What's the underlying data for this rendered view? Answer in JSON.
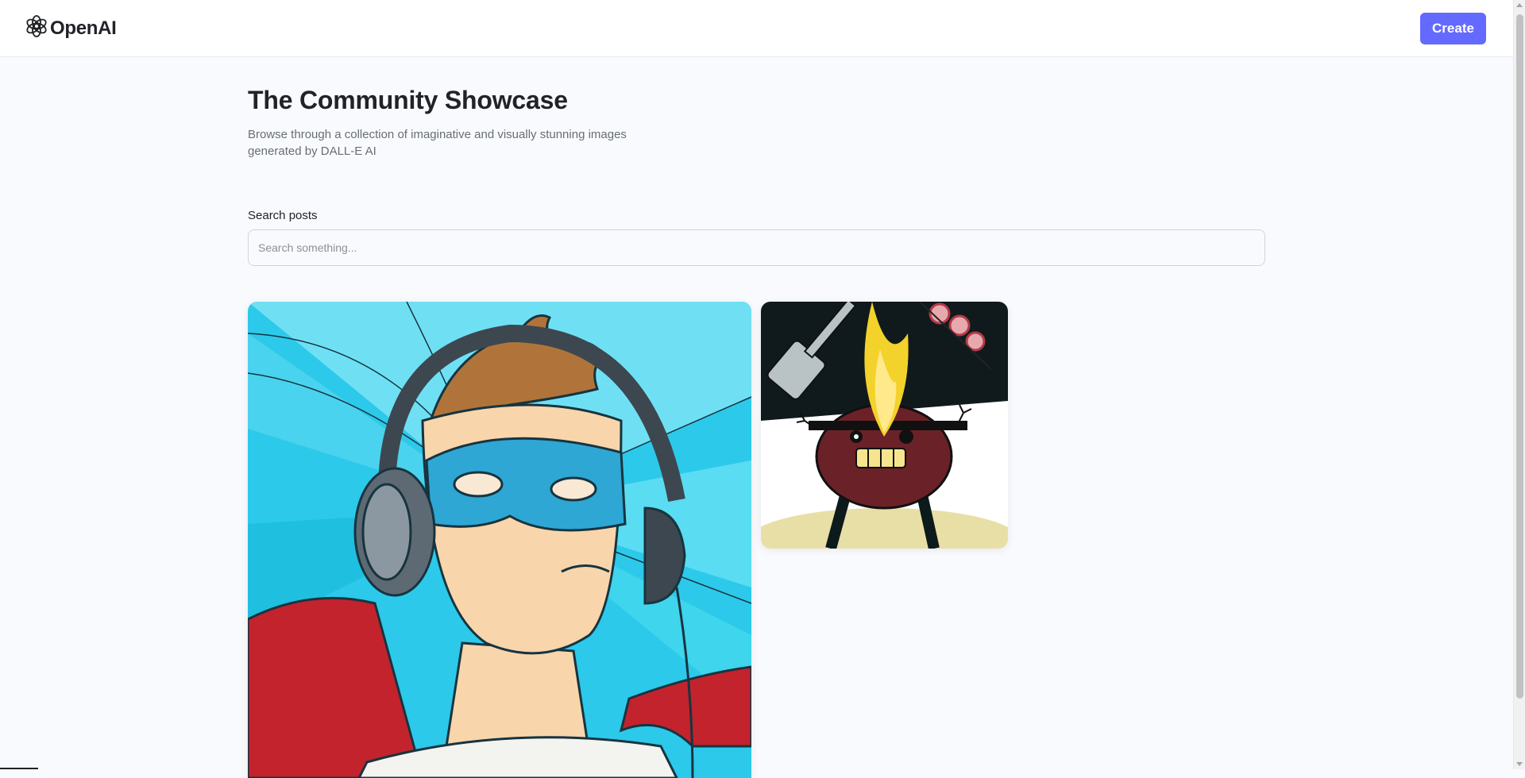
{
  "header": {
    "logo_text": "OpenAI",
    "logo_icon": "openai-knot-icon",
    "create_label": "Create"
  },
  "main": {
    "title": "The Community Showcase",
    "subtitle": "Browse through a collection of imaginative and visually stunning images generated by DALL-E AI"
  },
  "search": {
    "label": "Search posts",
    "placeholder": "Search something..."
  },
  "posts": [
    {
      "image_subject": "superhero-with-headphones"
    },
    {
      "image_subject": "smiling-grill-with-flame"
    }
  ],
  "colors": {
    "accent": "#6469ff",
    "background": "#f9fafe",
    "title": "#222328",
    "subtitle": "#666e75"
  }
}
